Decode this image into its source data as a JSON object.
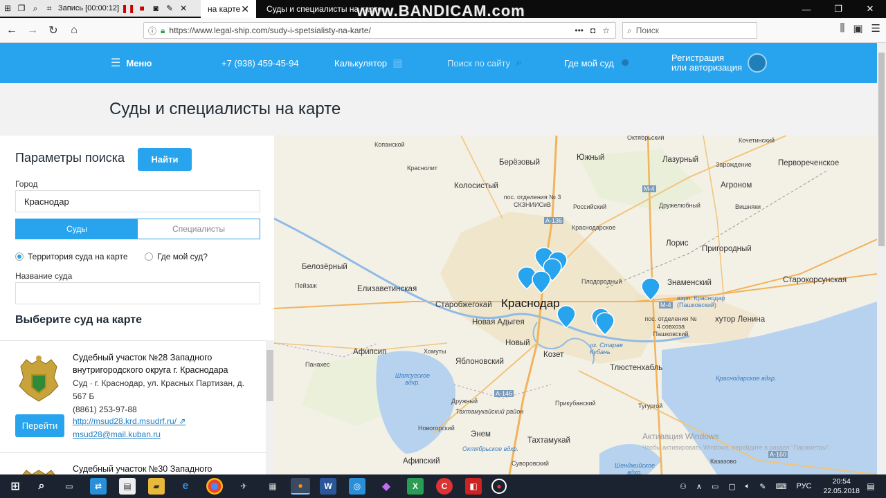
{
  "recorder": {
    "label": "Запись [00:00:12]"
  },
  "browser": {
    "tabs": [
      {
        "label": "на карте"
      },
      {
        "label": "Суды и специалисты на карте"
      }
    ],
    "watermark": "www.BANDICAM.com",
    "url": "https://www.legal-ship.com/sudy-i-spetsialisty-na-karte/",
    "search_placeholder": "Поиск"
  },
  "site": {
    "menu": "Меню",
    "phone": "+7 (938) 459-45-94",
    "calculator": "Калькулятор",
    "site_search": "Поиск по сайту",
    "where_court": "Где мой суд",
    "register_line1": "Регистрация",
    "register_line2": "или авторизация",
    "page_title": "Суды и специалисты на карте"
  },
  "panel": {
    "params_title": "Параметры поиска",
    "find_button": "Найти",
    "city_label": "Город",
    "city_value": "Краснодар",
    "tab_courts": "Суды",
    "tab_specialists": "Специалисты",
    "radio_territory": "Территория суда на карте",
    "radio_where": "Где мой суд?",
    "court_name_label": "Название суда",
    "court_name_value": "",
    "choose_title": "Выберите суд на карте",
    "entries": [
      {
        "title": "Судебный участок №28 Западного внутригородского округа г. Краснодара",
        "address": "Суд · г. Краснодар, ул. Красных Партизан, д. 567 Б",
        "phone": "(8861) 253-97-88",
        "site": "http://msud28.krd.msudrf.ru/",
        "email": "msud28@mail.kuban.ru",
        "go": "Перейти"
      },
      {
        "title": "Судебный участок №30 Западного"
      }
    ]
  },
  "map": {
    "labels": {
      "kopanskoy": "Копанской",
      "krasnolit": "Краснолит",
      "berezovy": "Берёзовый",
      "yuzhny": "Южный",
      "lazurny": "Лазурный",
      "kochetinsky": "Кочетинский",
      "zarozhdenie": "Зарождение",
      "pervorechenskoe": "Первореченское",
      "kolosisty": "Колосистый",
      "agronom": "Агроном",
      "pos_otd3": "пос. отделения № 3 СКЗНИИСиВ",
      "rossiysky": "Российский",
      "druzhelyubny": "Дружелюбный",
      "vishnyaki": "Вишняки",
      "krasnodarskoe": "Краснодарское",
      "oktyabrsky": "Октябрьский",
      "loris": "Лорис",
      "prigorodny": "Пригородный",
      "belozerny": "Белозёрный",
      "plodorodny": "Плодородный",
      "znamensky": "Знаменский",
      "starokorsunskaya": "Старокорсунская",
      "elizavetinskaya": "Елизаветинская",
      "peyzazh": "Пейзаж",
      "starobzhegokay": "Старобжегокай",
      "krasnodar": "Краснодар",
      "airport": "аэрп. Краснодар (Пашковский)",
      "novaya_adygeya": "Новая Адыгея",
      "pos_otd4": "пос. отделения № 4 совхоза Пашковский",
      "khutor_lenina": "хутор Ленина",
      "novy": "Новый",
      "afipsip": "Афипсип",
      "khomuty": "Хомуты",
      "yablonovsky": "Яблоновский",
      "kozet": "Козет",
      "staraya_kuban": "оз. Старая Кубань",
      "panakhes": "Панахес",
      "tlyustenkhabl": "Тлюстенхабль",
      "shapsug": "Шапсугское вдхр.",
      "krasnodar_res": "Краснодарское вдхр.",
      "druzhny": "Дружный",
      "prikubansky": "Прикубанский",
      "tugurgoy": "Тугургой",
      "takhtamukay_r": "Тахтамукайский район",
      "novogorsky": "Новогорский",
      "enem": "Энем",
      "takhtamukay": "Тахтамукай",
      "afipsky": "Афипский",
      "oktyabrskoe_res": "Октябрьское вдхр.",
      "suvorovsky": "Суворовский",
      "kazazovo": "Казазово",
      "shenzhiyskoe_res": "Шенджийское вдхр.",
      "a136": "А-136",
      "m4": "М-4",
      "m4b": "М-4",
      "a146": "А-146",
      "a160": "А-160"
    },
    "activate_windows": "Активация Windows",
    "activate_windows_sub": "Чтобы активировать Windows, перейдите в раздел \"Параметры\"."
  },
  "taskbar": {
    "lang": "РУС",
    "time": "20:54",
    "date": "22.05.2018"
  }
}
